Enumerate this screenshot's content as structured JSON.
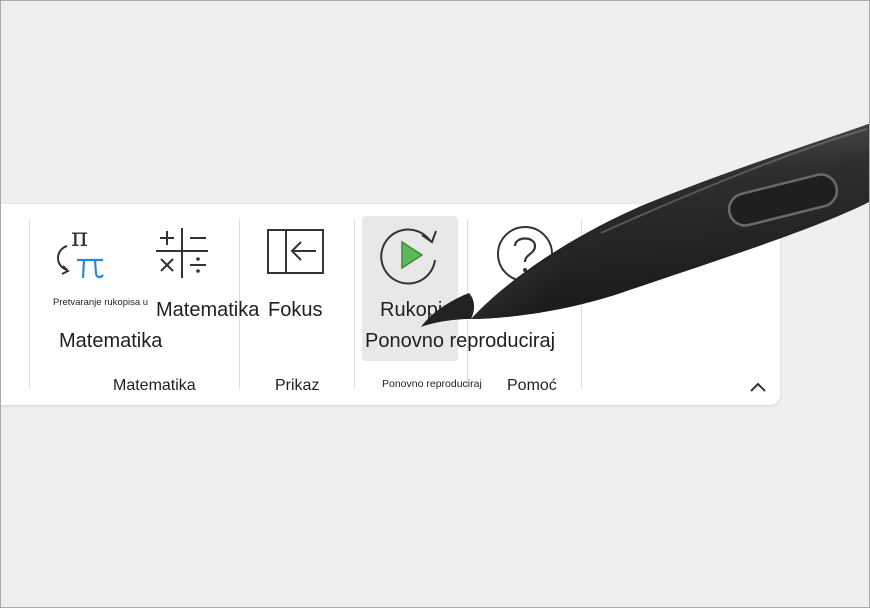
{
  "ribbon": {
    "buttons": {
      "ink_to_math": {
        "label": "Pretvaranje rukopisa u",
        "label2": "Matematika",
        "icon": "ink-to-math-icon",
        "color_blue": "#2b88d8"
      },
      "math": {
        "label": "Matematika",
        "icon": "math-operators-icon"
      },
      "focus": {
        "label": "Fokus",
        "icon": "focus-icon"
      },
      "ink_replay": {
        "label": "Rukopis",
        "label2": "Ponovno reproduciraj",
        "icon": "replay-icon",
        "color_green": "#5cb85c"
      },
      "help": {
        "label": "Pomoć",
        "icon": "help-icon"
      }
    },
    "groups": {
      "math": "Matematika",
      "view": "Prikaz",
      "replay": "Ponovno reproduciraj",
      "help": "Pomoć"
    },
    "collapse_icon": "chevron-up-icon"
  },
  "overlay": {
    "pen_icon": "stylus-pen"
  }
}
